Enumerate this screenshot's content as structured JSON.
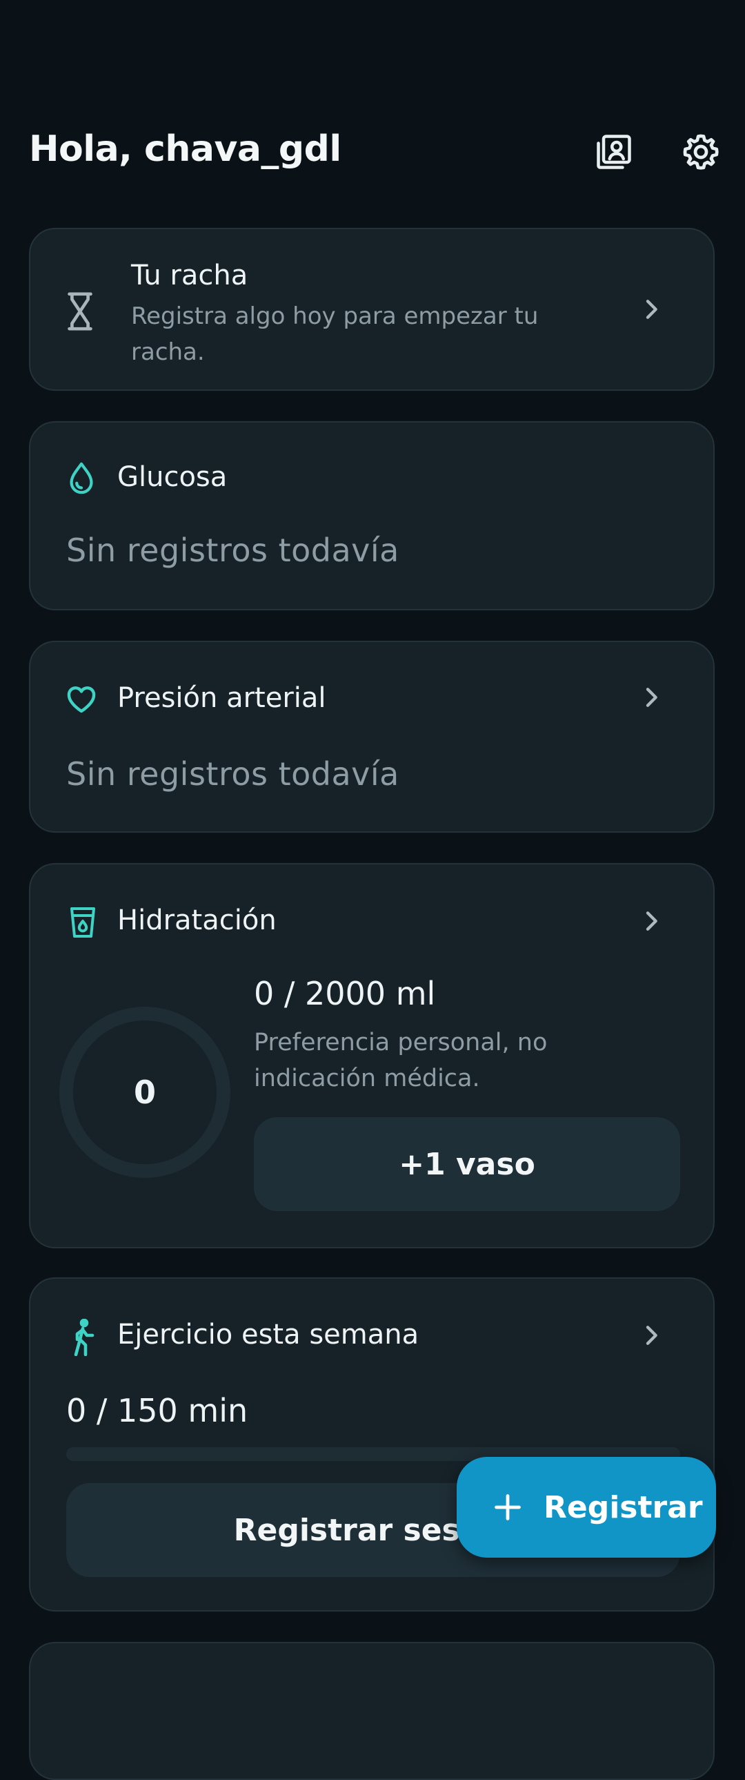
{
  "header": {
    "greeting": "Hola, chava_gdl",
    "icons": [
      "profile-card-icon",
      "gear-icon"
    ]
  },
  "streak": {
    "title": "Tu racha",
    "subtitle": "Registra algo hoy para empezar tu racha.",
    "icon": "hourglass-icon"
  },
  "glucose": {
    "title": "Glucosa",
    "empty": "Sin registros todavía",
    "icon": "drop-icon"
  },
  "pressure": {
    "title": "Presión arterial",
    "empty": "Sin registros todavía",
    "icon": "heart-icon"
  },
  "hydration": {
    "title": "Hidratación",
    "ring_value": "0",
    "amount": "0 / 2000 ml",
    "note": "Preferencia personal, no indicación médica.",
    "add_button": "+1 vaso",
    "progress": 0,
    "icon": "glass-icon"
  },
  "exercise": {
    "title": "Ejercicio esta semana",
    "amount": "0 / 150 min",
    "progress": 0,
    "button": "Registrar sesión",
    "icon": "walking-icon"
  },
  "fab": {
    "label": "Registrar",
    "icon": "plus-icon"
  },
  "colors": {
    "background": "#0b1217",
    "card": "#162228",
    "accent": "#3fd3c6",
    "fab": "#1095c6"
  }
}
